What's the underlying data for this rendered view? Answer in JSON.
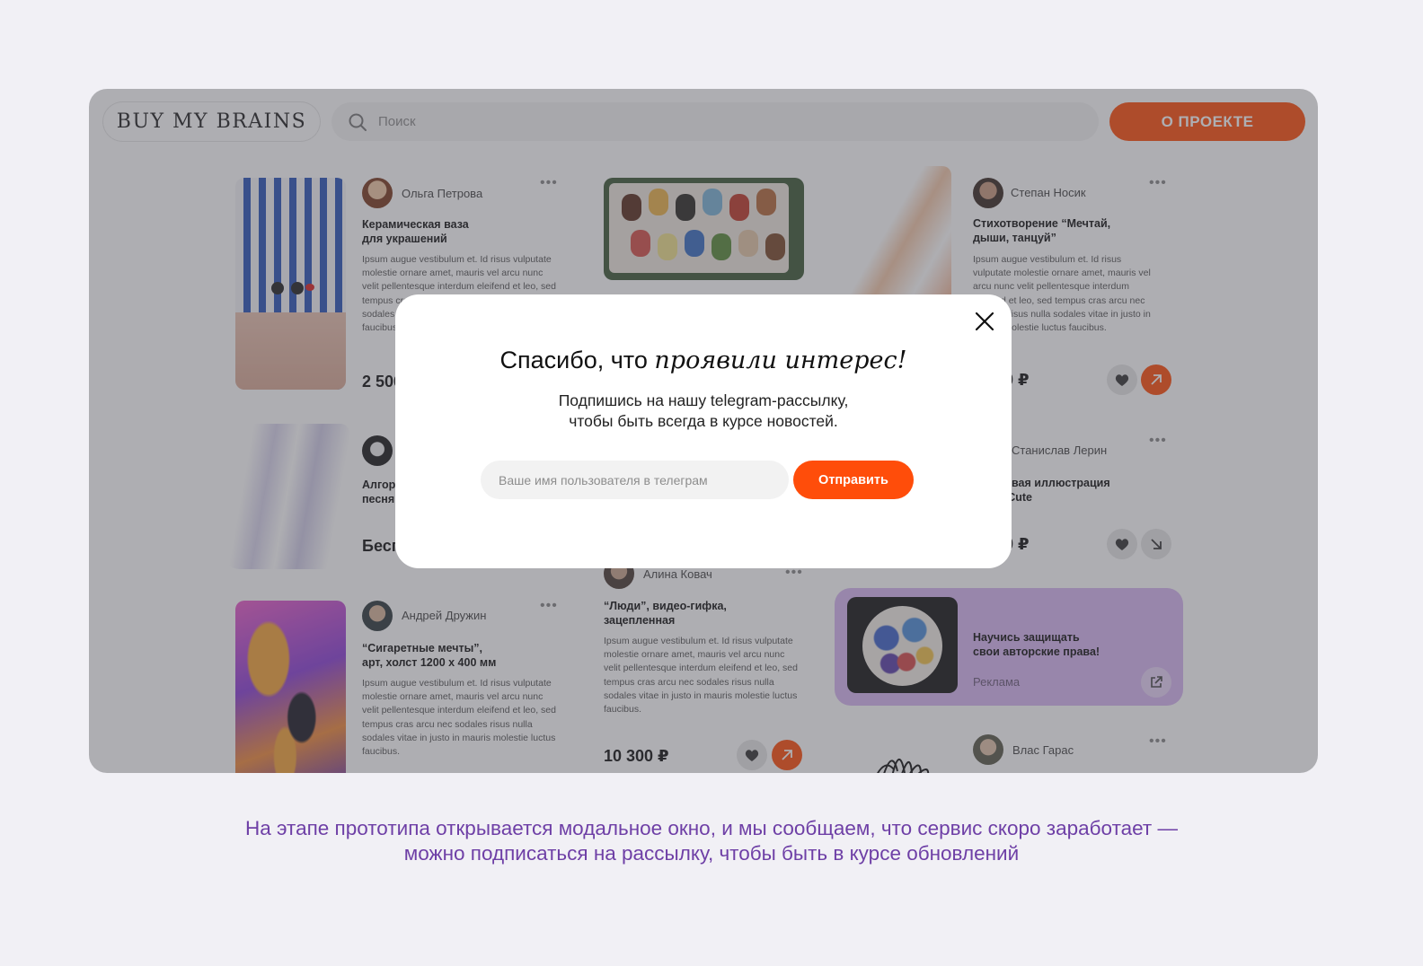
{
  "header": {
    "logo": "BUY MY BRAINS",
    "search_placeholder": "Поиск",
    "about_label": "О ПРОЕКТЕ"
  },
  "cards": {
    "c1": {
      "author": "Ольга Петрова",
      "title": "Керамическая ваза\nдля украшений",
      "description": "Ipsum augue vestibulum et. Id risus vulputate molestie ornare amet, mauris vel arcu nunc velit pellentesque interdum eleifend et leo, sed tempus cras arcu nec sodales risus nulla sodales vitae in justo in mauris molestie luctus faucibus.",
      "price": "2 500 ₽"
    },
    "c2": {},
    "c3": {
      "author": "Степан Носик",
      "title": "Стихотворение “Мечтай,\nдыши, танцуй”",
      "description": "Ipsum augue vestibulum et. Id risus vulputate molestie ornare amet, mauris vel arcu nunc velit pellentesque interdum eleifend et leo, sed tempus cras arcu nec sodales risus nulla sodales vitae in justo in mauris molestie luctus faucibus.",
      "price": "1 500 ₽"
    },
    "c4": {
      "title": "Алгоритмическая\nпесня",
      "price": "Бесплатно"
    },
    "c5": {
      "author": "Станислав Лерин",
      "title": "Цифровая иллюстрация\n«Cute Cute",
      "price": "2 000 ₽"
    },
    "c6": {
      "author": "Андрей Дружин",
      "title": "“Сигаретные мечты”,\nарт, холст 1200 x 400 мм",
      "description": "Ipsum augue vestibulum et. Id risus vulputate molestie ornare amet, mauris vel arcu nunc velit pellentesque interdum eleifend et leo, sed tempus cras arcu nec sodales risus nulla sodales vitae in justo in mauris molestie luctus faucibus."
    },
    "c7": {
      "author": "Алина Ковач",
      "title": "“Люди”, видео-гифка,\nзацепленная",
      "description": "Ipsum augue vestibulum et. Id risus vulputate molestie ornare amet, mauris vel arcu nunc velit pellentesque interdum eleifend et leo, sed tempus cras arcu nec sodales risus nulla sodales vitae in justo in mauris molestie luctus faucibus.",
      "price": "10 300 ₽"
    },
    "ad": {
      "title": "Научись защищать\nсвои авторские права!",
      "label": "Реклама"
    },
    "c8": {
      "author": "Влас Гарас"
    }
  },
  "modal": {
    "title_regular": "Спасибо, что ",
    "title_italic": "проявили интерес!",
    "subtitle": "Подпишись на нашу telegram-рассылку,\nчтобы быть всегда в курсе новостей.",
    "input_placeholder": "Ваше имя пользователя в телеграм",
    "submit_label": "Отправить"
  },
  "caption": "На этапе прототипа открывается модальное окно, и мы сообщаем, что сервис скоро заработает —\nможно подписаться на рассылку, чтобы быть в курсе обновлений",
  "colors": {
    "accent": "#ff4d0a",
    "caption": "#6e3fa6",
    "ad_background": "#d8b7f2"
  },
  "icons": {
    "search": "search-icon",
    "more": "more-dots-icon",
    "favorite": "heart-icon",
    "open": "arrow-up-right-icon",
    "open_down": "arrow-down-right-icon",
    "external": "external-link-icon",
    "close": "close-icon"
  }
}
